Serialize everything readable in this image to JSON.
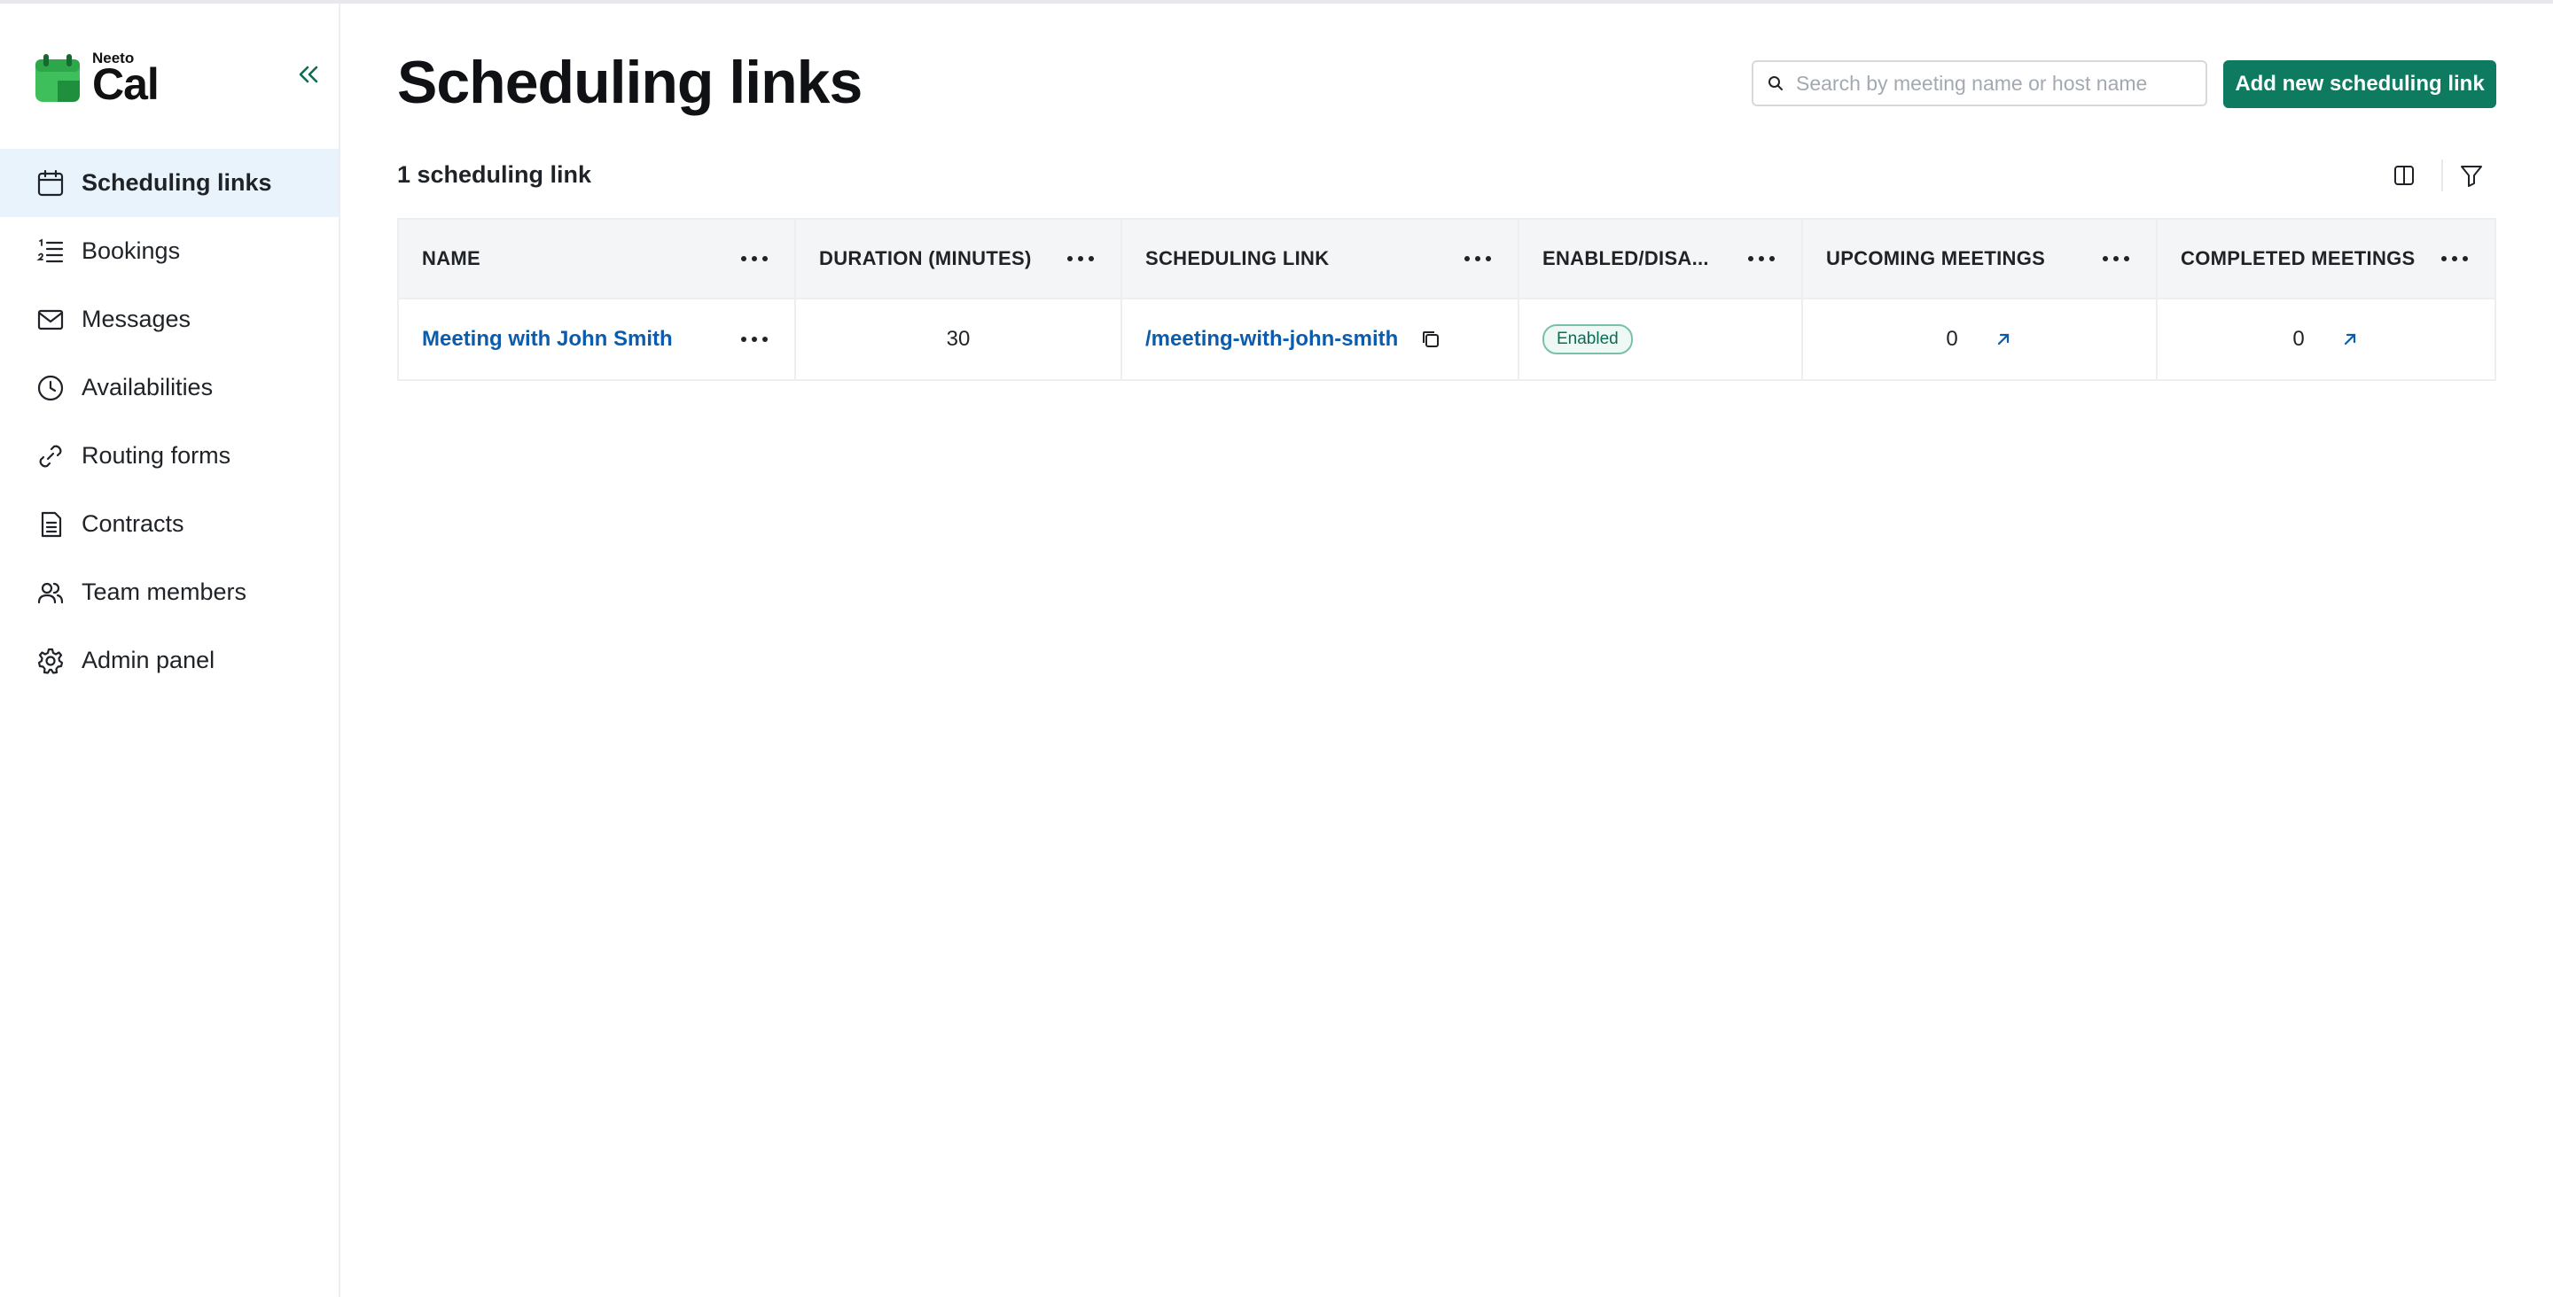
{
  "app": {
    "logo_small": "Neeto",
    "logo_big": "Cal"
  },
  "sidebar": {
    "items": [
      {
        "label": "Scheduling links",
        "icon": "calendar-icon",
        "active": true
      },
      {
        "label": "Bookings",
        "icon": "list-numbered-icon",
        "active": false
      },
      {
        "label": "Messages",
        "icon": "mail-icon",
        "active": false
      },
      {
        "label": "Availabilities",
        "icon": "clock-icon",
        "active": false
      },
      {
        "label": "Routing forms",
        "icon": "link-icon",
        "active": false
      },
      {
        "label": "Contracts",
        "icon": "document-icon",
        "active": false
      },
      {
        "label": "Team members",
        "icon": "users-icon",
        "active": false
      },
      {
        "label": "Admin panel",
        "icon": "gear-icon",
        "active": false
      }
    ]
  },
  "header": {
    "title": "Scheduling links",
    "search_placeholder": "Search by meeting name or host name",
    "add_button": "Add new scheduling link"
  },
  "summary": {
    "count_label": "1 scheduling link"
  },
  "table": {
    "columns": [
      "NAME",
      "DURATION (MINUTES)",
      "SCHEDULING LINK",
      "ENABLED/DISA...",
      "UPCOMING MEETINGS",
      "COMPLETED MEETINGS"
    ],
    "rows": [
      {
        "name": "Meeting with John Smith",
        "duration": "30",
        "link": "/meeting-with-john-smith",
        "status": "Enabled",
        "upcoming": "0",
        "completed": "0"
      }
    ]
  },
  "colors": {
    "primary": "#0e7a5f",
    "link": "#0b5cad",
    "active_nav_bg": "#e8f3fb"
  }
}
